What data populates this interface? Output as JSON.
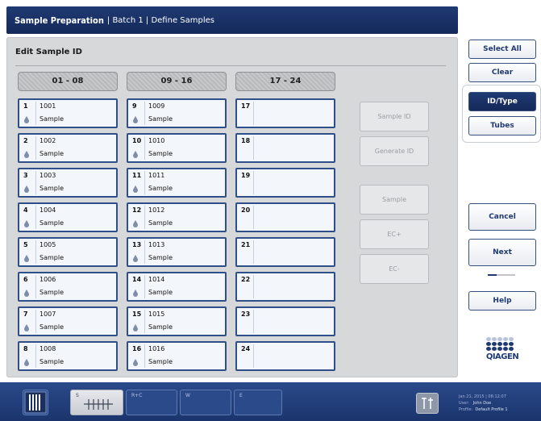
{
  "header": {
    "title_main": "Sample Preparation",
    "title_rest": "| Batch 1 | Define Samples"
  },
  "panel": {
    "title": "Edit Sample ID"
  },
  "column_tabs": [
    "01 - 08",
    "09 - 16",
    "17 - 24"
  ],
  "slots": [
    {
      "num": "1",
      "id": "1001",
      "type": "Sample"
    },
    {
      "num": "2",
      "id": "1002",
      "type": "Sample"
    },
    {
      "num": "3",
      "id": "1003",
      "type": "Sample"
    },
    {
      "num": "4",
      "id": "1004",
      "type": "Sample"
    },
    {
      "num": "5",
      "id": "1005",
      "type": "Sample"
    },
    {
      "num": "6",
      "id": "1006",
      "type": "Sample"
    },
    {
      "num": "7",
      "id": "1007",
      "type": "Sample"
    },
    {
      "num": "8",
      "id": "1008",
      "type": "Sample"
    },
    {
      "num": "9",
      "id": "1009",
      "type": "Sample"
    },
    {
      "num": "10",
      "id": "1010",
      "type": "Sample"
    },
    {
      "num": "11",
      "id": "1011",
      "type": "Sample"
    },
    {
      "num": "12",
      "id": "1012",
      "type": "Sample"
    },
    {
      "num": "13",
      "id": "1013",
      "type": "Sample"
    },
    {
      "num": "14",
      "id": "1014",
      "type": "Sample"
    },
    {
      "num": "15",
      "id": "1015",
      "type": "Sample"
    },
    {
      "num": "16",
      "id": "1016",
      "type": "Sample"
    },
    {
      "num": "17",
      "id": "",
      "type": ""
    },
    {
      "num": "18",
      "id": "",
      "type": ""
    },
    {
      "num": "19",
      "id": "",
      "type": ""
    },
    {
      "num": "20",
      "id": "",
      "type": ""
    },
    {
      "num": "21",
      "id": "",
      "type": ""
    },
    {
      "num": "22",
      "id": "",
      "type": ""
    },
    {
      "num": "23",
      "id": "",
      "type": ""
    },
    {
      "num": "24",
      "id": "",
      "type": ""
    }
  ],
  "side_buttons": {
    "sample_id": "Sample ID",
    "generate_id": "Generate ID",
    "sample": "Sample",
    "ec_plus": "EC+",
    "ec_minus": "EC-"
  },
  "right": {
    "select_all": "Select All",
    "clear": "Clear",
    "id_type": "ID/Type",
    "tubes": "Tubes",
    "cancel": "Cancel",
    "next": "Next",
    "help": "Help",
    "step_progress": 0.33
  },
  "logo": {
    "text": "QIAGEN"
  },
  "footer": {
    "tabs": [
      "S",
      "R+C",
      "W",
      "E"
    ],
    "datetime": "Jan 21, 2015 | 08:12:07",
    "user_label": "User:",
    "user_value": "John Doe",
    "profile_label": "Profile:",
    "profile_value": "Default Profile 1"
  },
  "colors": {
    "brand": "#1f3a73",
    "accent": "#2b4a8a",
    "slot_border": "#2f4f8a"
  },
  "icons": {
    "drop": "drop-icon",
    "tools": "tools-icon",
    "rack": "tube-rack-icon",
    "tubes": "tube-strip-icon"
  }
}
